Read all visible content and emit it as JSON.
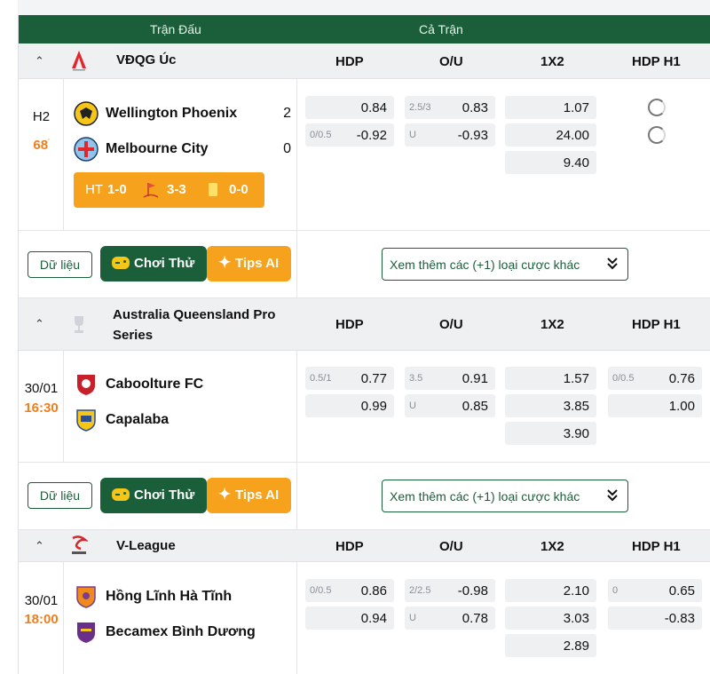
{
  "header": {
    "col_match": "Trận Đấu",
    "col_full": "Cả Trận"
  },
  "columns": {
    "hdp": "HDP",
    "ou": "O/U",
    "x12": "1X2",
    "hdp_h1": "HDP H1"
  },
  "colors": {
    "brand_green": "#1b5e3a",
    "accent_orange": "#f7a21c",
    "minute_orange": "#f07e1c"
  },
  "icons": {
    "collapse": "chevron-up-icon",
    "loading": "spinner-icon",
    "play": "gamepad-icon",
    "tips": "sparkle-icon",
    "more": "double-chevron-down-icon",
    "yellow_card": "yellow-card-icon",
    "corner": "corner-flag-icon"
  },
  "leagues": [
    {
      "name": "VĐQG Úc",
      "match": {
        "time_top": "H2",
        "time_bottom": "68",
        "home": {
          "name": "Wellington Phoenix",
          "score": "2"
        },
        "away": {
          "name": "Melbourne City",
          "score": "0"
        },
        "stats": {
          "ht_label": "HT",
          "ht_score": "1-0",
          "corners": "3-3",
          "cards": "0-0"
        },
        "hdp": [
          {
            "line": "",
            "value": "0.84"
          },
          {
            "line": "0/0.5",
            "value": "-0.92"
          }
        ],
        "ou": [
          {
            "line": "2.5/3",
            "value": "0.83"
          },
          {
            "line": "U",
            "value": "-0.93"
          }
        ],
        "x12": [
          "1.07",
          "24.00",
          "9.40"
        ]
      }
    },
    {
      "name": "Australia Queensland Pro Series",
      "match": {
        "time_top": "30/01",
        "time_bottom": "16:30",
        "home": {
          "name": "Caboolture FC",
          "score": ""
        },
        "away": {
          "name": "Capalaba",
          "score": ""
        },
        "hdp": [
          {
            "line": "0.5/1",
            "value": "0.77"
          },
          {
            "line": "",
            "value": "0.99"
          }
        ],
        "ou": [
          {
            "line": "3.5",
            "value": "0.91"
          },
          {
            "line": "U",
            "value": "0.85"
          }
        ],
        "x12": [
          "1.57",
          "3.85",
          "3.90"
        ],
        "hdp_h1": [
          {
            "line": "0/0.5",
            "value": "0.76"
          },
          {
            "line": "",
            "value": "1.00"
          }
        ]
      }
    },
    {
      "name": "V-League",
      "match": {
        "time_top": "30/01",
        "time_bottom": "18:00",
        "home": {
          "name": "Hồng Lĩnh Hà Tĩnh",
          "score": ""
        },
        "away": {
          "name": "Becamex Bình Dương",
          "score": ""
        },
        "hdp": [
          {
            "line": "0/0.5",
            "value": "0.86"
          },
          {
            "line": "",
            "value": "0.94"
          }
        ],
        "ou": [
          {
            "line": "2/2.5",
            "value": "-0.98"
          },
          {
            "line": "U",
            "value": "0.78"
          }
        ],
        "x12": [
          "2.10",
          "3.03",
          "2.89"
        ],
        "hdp_h1": [
          {
            "line": "0",
            "value": "0.65"
          },
          {
            "line": "",
            "value": "-0.83"
          }
        ]
      }
    }
  ],
  "actions": {
    "data": "Dữ liệu",
    "play": "Chơi Thử",
    "tips": "Tips AI",
    "more": "Xem thêm các (+1) loại cược khác"
  }
}
